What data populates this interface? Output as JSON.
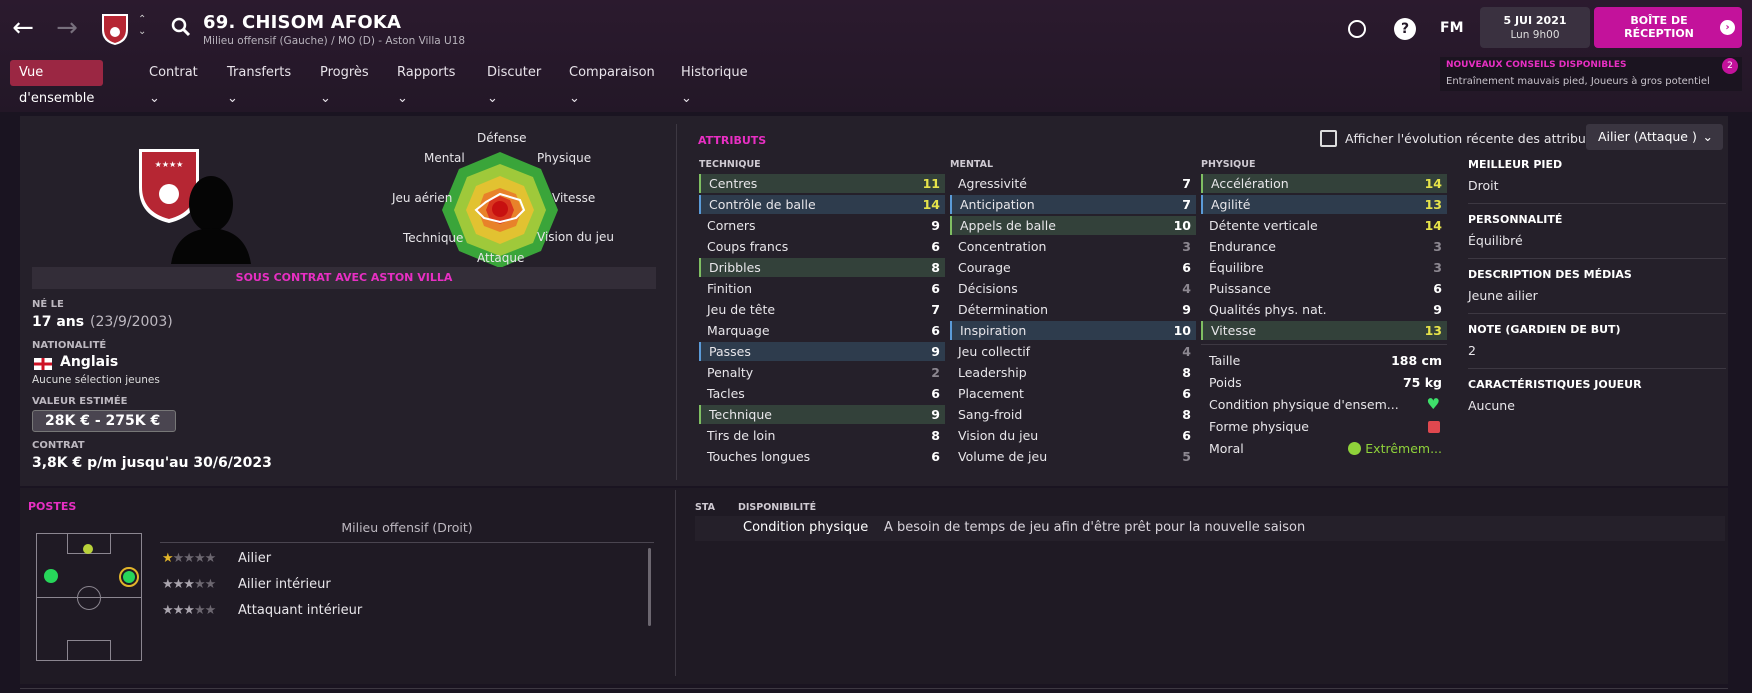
{
  "player": {
    "title": "69. CHISOM AFOKA",
    "subtitle": "Milieu offensif (Gauche) / MO (D) - Aston Villa U18"
  },
  "header": {
    "fm_label": "FM",
    "date_line1": "5 JUI 2021",
    "date_line2": "Lun 9h00",
    "inbox_label": "BOÎTE DE RÉCEPTION",
    "help_label": "?",
    "notif_title": "NOUVEAUX CONSEILS DISPONIBLES",
    "notif_text": "Entraînement mauvais pied, Joueurs à gros potentiel",
    "notif_count": "2"
  },
  "menu": [
    {
      "label": "Vue d'ensemble"
    },
    {
      "label": "Contrat"
    },
    {
      "label": "Transferts"
    },
    {
      "label": "Progrès"
    },
    {
      "label": "Rapports"
    },
    {
      "label": "Discuter"
    },
    {
      "label": "Comparaison"
    },
    {
      "label": "Historique"
    }
  ],
  "overview": {
    "contract_banner": "SOUS CONTRAT AVEC ASTON VILLA",
    "born_label": "NÉ LE",
    "age": "17 ans",
    "dob": "(23/9/2003)",
    "nationality_label": "NATIONALITÉ",
    "nationality": "Anglais",
    "caps": "Aucune sélection jeunes",
    "value_label": "VALEUR ESTIMÉE",
    "value": "28K € - 275K €",
    "contract_label": "CONTRAT",
    "contract": "3,8K € p/m jusqu'au 30/6/2023"
  },
  "radar": {
    "labels": [
      "Défense",
      "Physique",
      "Vitesse",
      "Vision du jeu",
      "Attaque",
      "Technique",
      "Jeu aérien",
      "Mental"
    ]
  },
  "attributes": {
    "title": "ATTRIBUTS",
    "toggle_label": "Afficher l'évolution récente des attributs",
    "role": "Ailier (Attaque )",
    "technique_label": "TECHNIQUE",
    "mental_label": "MENTAL",
    "physique_label": "PHYSIQUE",
    "technique": [
      {
        "name": "Centres",
        "value": "11"
      },
      {
        "name": "Contrôle de balle",
        "value": "14"
      },
      {
        "name": "Corners",
        "value": "9"
      },
      {
        "name": "Coups francs",
        "value": "6"
      },
      {
        "name": "Dribbles",
        "value": "8"
      },
      {
        "name": "Finition",
        "value": "6"
      },
      {
        "name": "Jeu de tête",
        "value": "7"
      },
      {
        "name": "Marquage",
        "value": "6"
      },
      {
        "name": "Passes",
        "value": "9"
      },
      {
        "name": "Penalty",
        "value": "2"
      },
      {
        "name": "Tacles",
        "value": "6"
      },
      {
        "name": "Technique",
        "value": "9"
      },
      {
        "name": "Tirs de loin",
        "value": "8"
      },
      {
        "name": "Touches longues",
        "value": "6"
      }
    ],
    "mental": [
      {
        "name": "Agressivité",
        "value": "7"
      },
      {
        "name": "Anticipation",
        "value": "7"
      },
      {
        "name": "Appels de balle",
        "value": "10"
      },
      {
        "name": "Concentration",
        "value": "3"
      },
      {
        "name": "Courage",
        "value": "6"
      },
      {
        "name": "Décisions",
        "value": "4"
      },
      {
        "name": "Détermination",
        "value": "9"
      },
      {
        "name": "Inspiration",
        "value": "10"
      },
      {
        "name": "Jeu collectif",
        "value": "4"
      },
      {
        "name": "Leadership",
        "value": "8"
      },
      {
        "name": "Placement",
        "value": "6"
      },
      {
        "name": "Sang-froid",
        "value": "8"
      },
      {
        "name": "Vision du jeu",
        "value": "6"
      },
      {
        "name": "Volume de jeu",
        "value": "5"
      }
    ],
    "physique": [
      {
        "name": "Accélération",
        "value": "14"
      },
      {
        "name": "Agilité",
        "value": "13"
      },
      {
        "name": "Détente verticale",
        "value": "14"
      },
      {
        "name": "Endurance",
        "value": "3"
      },
      {
        "name": "Équilibre",
        "value": "3"
      },
      {
        "name": "Puissance",
        "value": "6"
      },
      {
        "name": "Qualités phys. nat.",
        "value": "9"
      },
      {
        "name": "Vitesse",
        "value": "13"
      }
    ],
    "height_label": "Taille",
    "height": "188 cm",
    "weight_label": "Poids",
    "weight": "75 kg",
    "condition_label": "Condition physique d'ensem...",
    "form_label": "Forme physique",
    "morale_label": "Moral",
    "morale": "Extrêmem..."
  },
  "side": {
    "foot_label": "MEILLEUR PIED",
    "foot": "Droit",
    "personality_label": "PERSONNALITÉ",
    "personality": "Équilibré",
    "media_label": "DESCRIPTION DES MÉDIAS",
    "media": "Jeune ailier",
    "gk_label": "NOTE (GARDIEN DE BUT)",
    "gk": "2",
    "traits_label": "CARACTÉRISTIQUES JOUEUR",
    "traits": "Aucune"
  },
  "positions": {
    "title": "POSTES",
    "main": "Milieu offensif (Droit)",
    "roles": [
      {
        "name": "Ailier",
        "stars": 1
      },
      {
        "name": "Ailier intérieur",
        "stars": 3
      },
      {
        "name": "Attaquant intérieur",
        "stars": 3
      }
    ]
  },
  "availability": {
    "sta_label": "STA",
    "dispo_label": "DISPONIBILITÉ",
    "item": "Condition physique",
    "text": "A besoin de temps de jeu afin d'être prêt pour la nouvelle saison"
  },
  "colors": {
    "accent": "#e82fc3",
    "menu_active": "#9b2743",
    "highlight_value": "#e6e34a"
  }
}
